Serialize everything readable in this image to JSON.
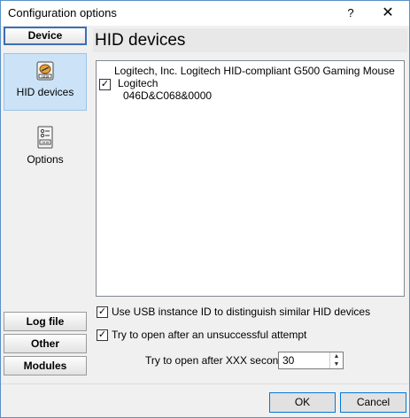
{
  "window": {
    "title": "Configuration options",
    "help_label": "?",
    "close_label": "✕"
  },
  "nav": {
    "device_header": "Device",
    "items": [
      {
        "label": "HID devices",
        "icon": "hid-device-icon",
        "selected": true
      },
      {
        "label": "Options",
        "icon": "options-icon",
        "selected": false
      }
    ],
    "bottom_buttons": [
      "Log file",
      "Other",
      "Modules"
    ]
  },
  "main": {
    "title": "HID devices",
    "tree": {
      "device_name": "Logitech, Inc. Logitech HID-compliant G500 Gaming Mouse",
      "vendor_label": "Logitech",
      "vendor_checked": true,
      "device_id": "046D&C068&0000"
    },
    "options": {
      "usb_instance_label": "Use USB instance ID to distinguish similar HID devices",
      "usb_instance_checked": true,
      "retry_label": "Try to open after an unsuccessful attempt",
      "retry_checked": true,
      "retry_seconds_label": "Try to open after XXX seconds",
      "retry_seconds_value": "30"
    }
  },
  "footer": {
    "ok_label": "OK",
    "cancel_label": "Cancel"
  },
  "colors": {
    "selected_bg": "#cce3f7",
    "accent": "#0078d7"
  }
}
